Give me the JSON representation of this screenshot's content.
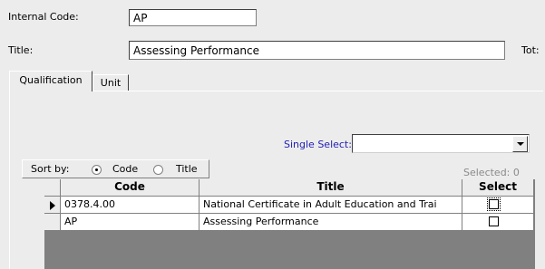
{
  "form": {
    "internal_code_label": "Internal Code:",
    "internal_code_value": "AP",
    "title_label": "Title:",
    "title_value": "Assessing Performance",
    "total_label": "Tot:"
  },
  "tabs": [
    {
      "label": "Qualification",
      "active": true
    },
    {
      "label": "Unit",
      "active": false
    }
  ],
  "single_select": {
    "label": "Single Select:",
    "value": ""
  },
  "sort": {
    "label": "Sort by:",
    "options": [
      {
        "label": "Code",
        "selected": true
      },
      {
        "label": "Title",
        "selected": false
      }
    ]
  },
  "selected_status": "Selected: 0",
  "grid": {
    "columns": [
      "Code",
      "Title",
      "Select"
    ],
    "rows": [
      {
        "code": "0378.4.00",
        "title": "National Certificate in Adult Education and Trai",
        "select": false,
        "current": true
      },
      {
        "code": "AP",
        "title": "Assessing Performance",
        "select": false,
        "current": false
      }
    ]
  }
}
